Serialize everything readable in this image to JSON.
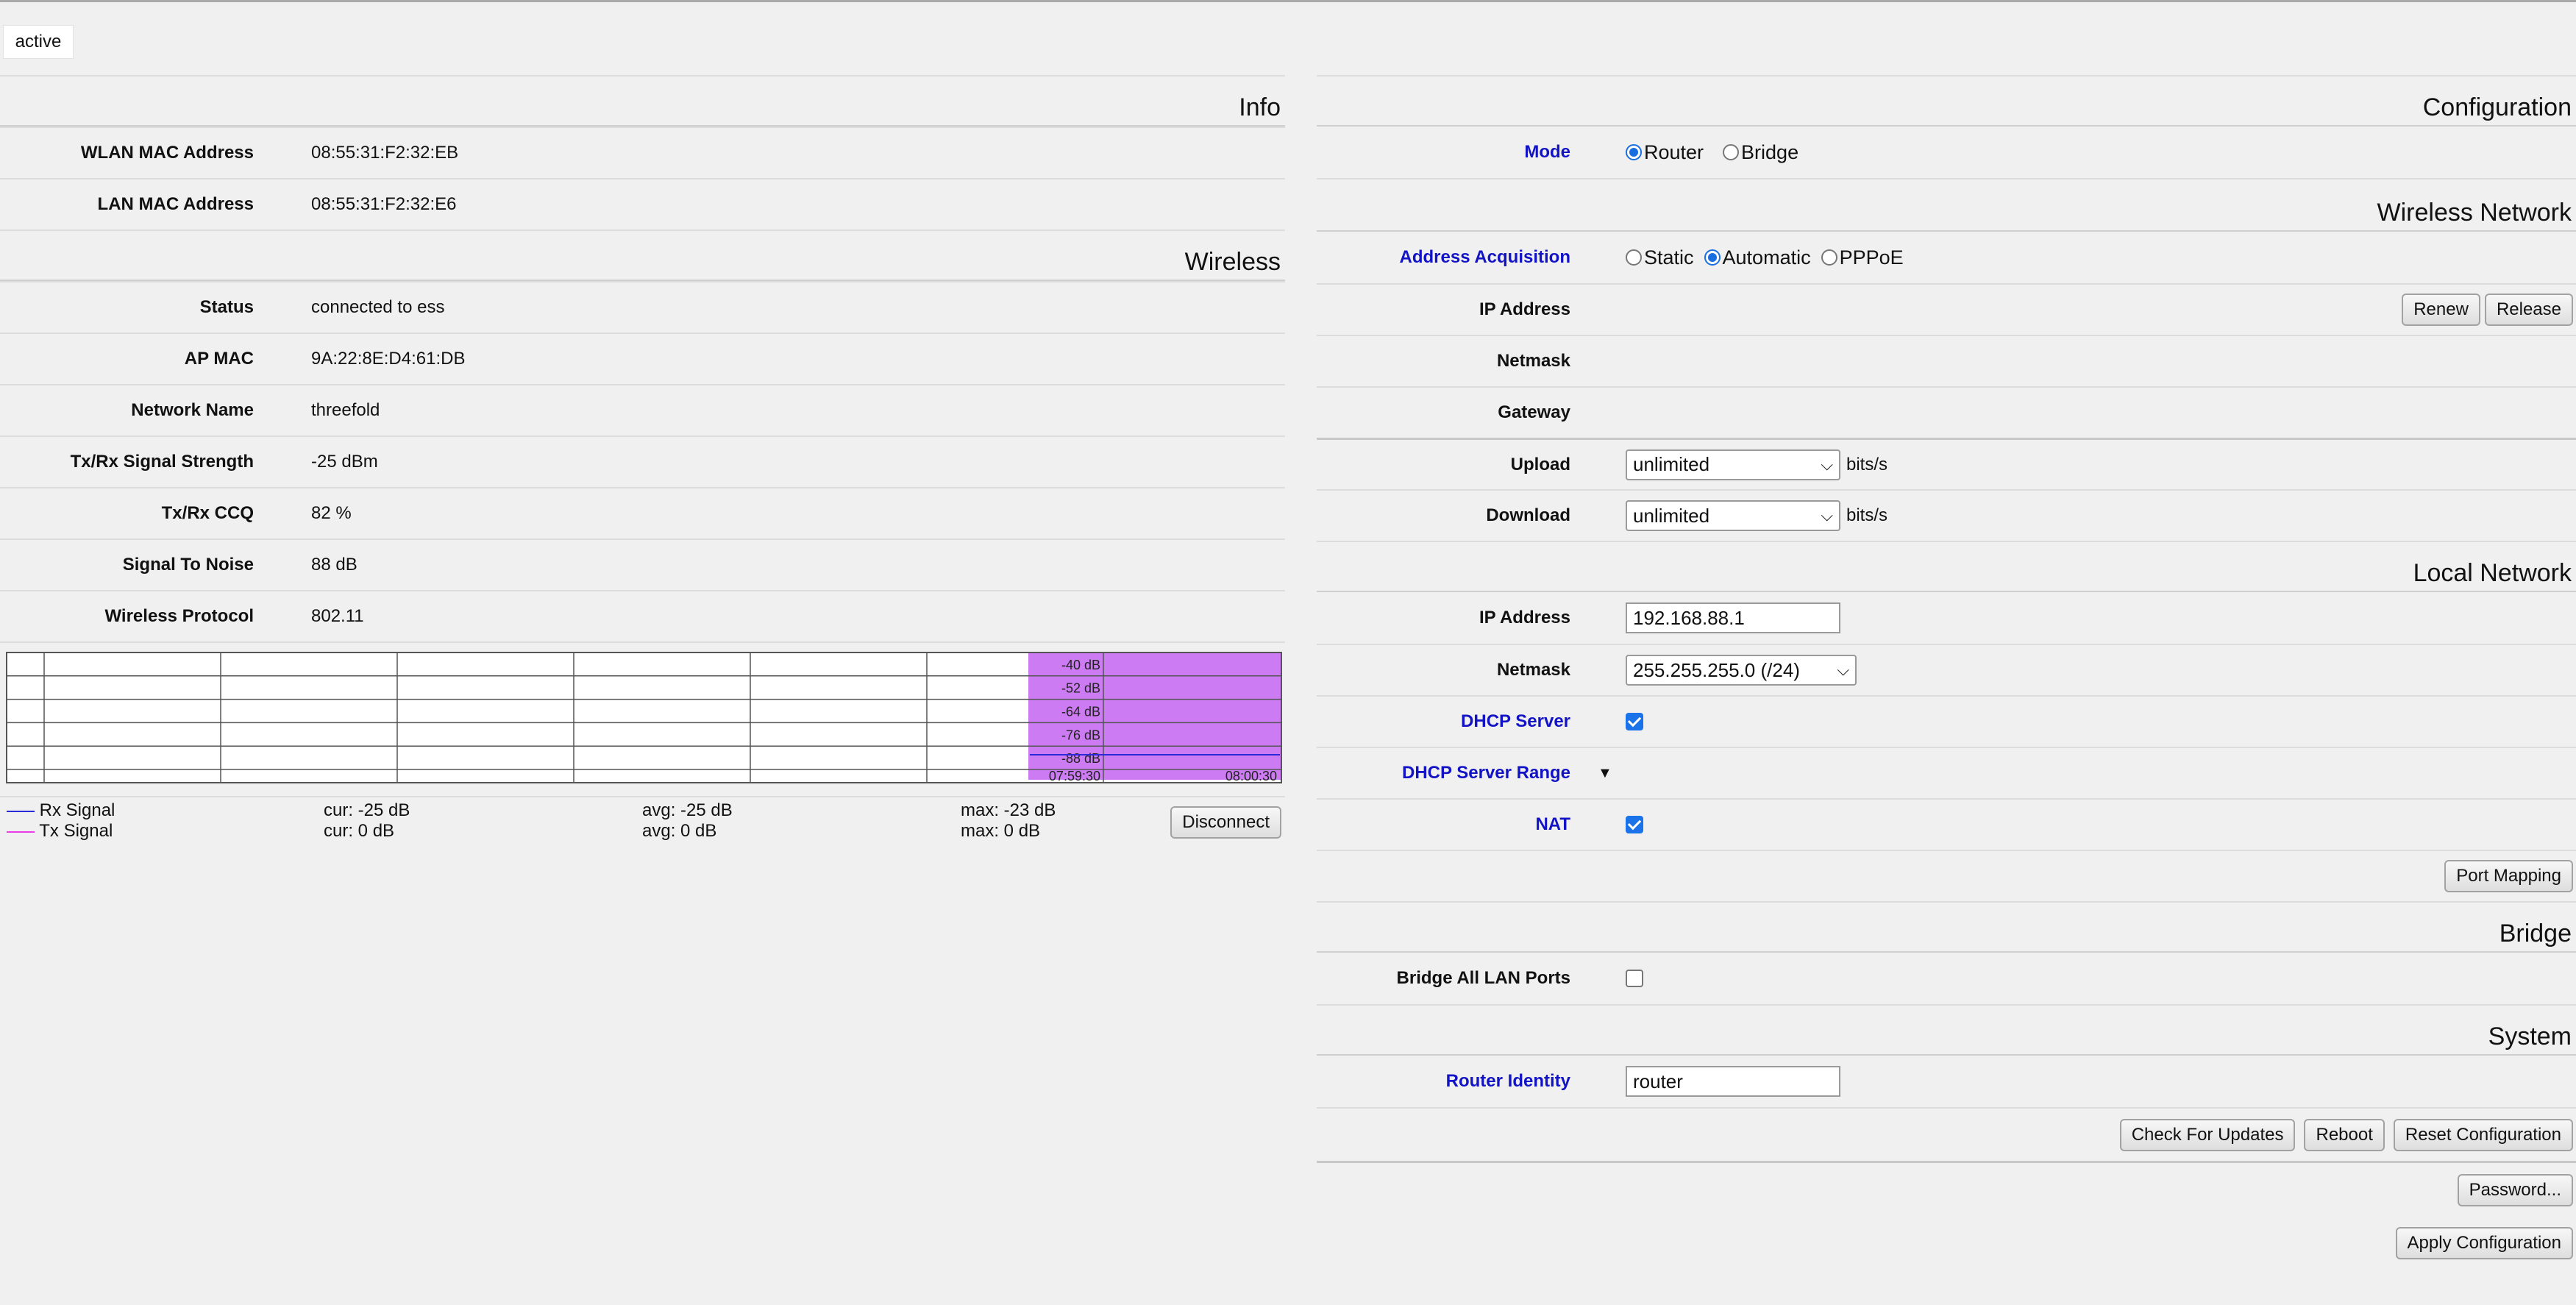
{
  "tab": {
    "label": "active"
  },
  "info": {
    "title": "Info",
    "wlan_mac_label": "WLAN MAC Address",
    "wlan_mac_value": "08:55:31:F2:32:EB",
    "lan_mac_label": "LAN MAC Address",
    "lan_mac_value": "08:55:31:F2:32:E6"
  },
  "wireless": {
    "title": "Wireless",
    "rows": [
      {
        "label": "Status",
        "value": "connected to ess"
      },
      {
        "label": "AP MAC",
        "value": "9A:22:8E:D4:61:DB"
      },
      {
        "label": "Network Name",
        "value": "threefold"
      },
      {
        "label": "Tx/Rx Signal Strength",
        "value": "-25 dBm"
      },
      {
        "label": "Tx/Rx CCQ",
        "value": "82 %"
      },
      {
        "label": "Signal To Noise",
        "value": "88 dB"
      },
      {
        "label": "Wireless Protocol",
        "value": "802.11"
      }
    ],
    "disconnect_label": "Disconnect"
  },
  "chart_data": {
    "type": "area",
    "y_ticks": [
      "-40 dB",
      "-52 dB",
      "-64 dB",
      "-76 dB",
      "-88 dB"
    ],
    "x_ticks": [
      "07:59:30",
      "08:00:30"
    ],
    "highlight_color": "#cc7bf2",
    "series": [
      {
        "name": "Rx Signal",
        "color": "#2a2ad8",
        "cur": "cur: -25 dB",
        "avg": "avg: -25 dB",
        "max": "max: -23 dB"
      },
      {
        "name": "Tx Signal",
        "color": "#e83ce8",
        "cur": "cur: 0 dB",
        "avg": "avg: 0 dB",
        "max": "max: 0 dB"
      }
    ]
  },
  "config": {
    "title": "Configuration",
    "mode_label": "Mode",
    "mode_options": [
      "Router",
      "Bridge"
    ],
    "mode_selected": "Router"
  },
  "wan": {
    "title": "Wireless Network",
    "acq_label": "Address Acquisition",
    "acq_options": [
      "Static",
      "Automatic",
      "PPPoE"
    ],
    "acq_selected": "Automatic",
    "ip_label": "IP Address",
    "renew_label": "Renew",
    "release_label": "Release",
    "netmask_label": "Netmask",
    "gateway_label": "Gateway",
    "upload_label": "Upload",
    "upload_value": "unlimited",
    "download_label": "Download",
    "download_value": "unlimited",
    "unit": "bits/s"
  },
  "lan": {
    "title": "Local Network",
    "ip_label": "IP Address",
    "ip_value": "192.168.88.1",
    "netmask_label": "Netmask",
    "netmask_value": "255.255.255.0 (/24)",
    "dhcp_label": "DHCP Server",
    "dhcp_checked": true,
    "dhcp_range_label": "DHCP Server Range",
    "nat_label": "NAT",
    "nat_checked": true,
    "port_mapping_label": "Port Mapping"
  },
  "bridge": {
    "title": "Bridge",
    "all_ports_label": "Bridge All LAN Ports",
    "all_ports_checked": false
  },
  "system": {
    "title": "System",
    "identity_label": "Router Identity",
    "identity_value": "router",
    "check_updates_label": "Check For Updates",
    "reboot_label": "Reboot",
    "reset_label": "Reset Configuration",
    "password_label": "Password...",
    "apply_label": "Apply Configuration"
  }
}
